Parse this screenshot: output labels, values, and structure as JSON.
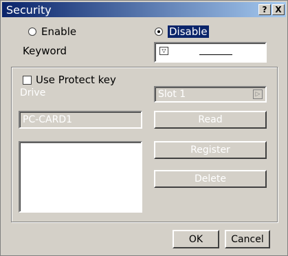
{
  "window": {
    "title": "Security",
    "help_label": "?",
    "close_label": "X"
  },
  "mode": {
    "enable_label": "Enable",
    "disable_label": "Disable",
    "selected": "Disable"
  },
  "keyword": {
    "label": "Keyword",
    "value": ""
  },
  "protect": {
    "use_key_label": "Use Protect key",
    "drive_label": "Drive",
    "slot_value": "Slot 1",
    "card_value": "PC-CARD1",
    "read_label": "Read",
    "register_label": "Register",
    "delete_label": "Delete"
  },
  "buttons": {
    "ok_label": "OK",
    "cancel_label": "Cancel"
  }
}
